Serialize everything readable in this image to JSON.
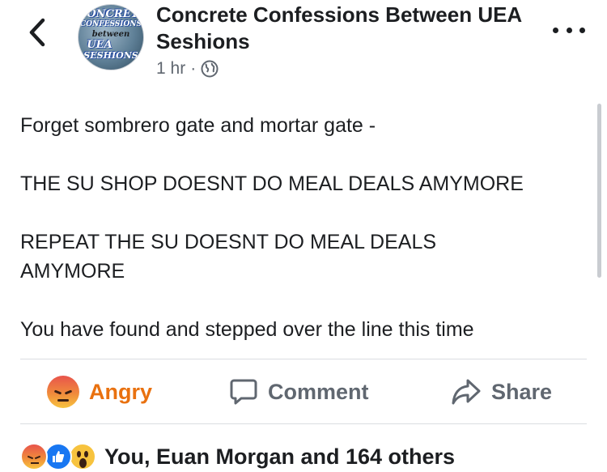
{
  "header": {
    "back_icon": "chevron-left-icon",
    "avatar_lines": [
      "CONCRETE",
      "CONFESSIONS",
      "between",
      "UEA",
      "SESHIONS"
    ],
    "title": "Concrete Confessions Between UEA Seshions",
    "time": "1 hr",
    "separator": "·",
    "privacy_icon": "globe-icon",
    "more_icon": "more-horizontal-icon"
  },
  "post": {
    "paragraphs": [
      "Forget sombrero gate and mortar gate -",
      "THE SU SHOP DOESNT DO MEAL DEALS AMYMORE",
      "REPEAT THE SU DOESNT DO MEAL DEALS AMYMORE",
      "You have found and stepped over the line this time"
    ]
  },
  "actions": {
    "react_label": "Angry",
    "comment_label": "Comment",
    "share_label": "Share",
    "colors": {
      "angry": "#e9710f",
      "neutral": "#606770"
    }
  },
  "reactions": {
    "icons": [
      "angry-emoji",
      "like-icon",
      "wow-emoji"
    ],
    "summary": "You, Euan Morgan and 164 others"
  }
}
